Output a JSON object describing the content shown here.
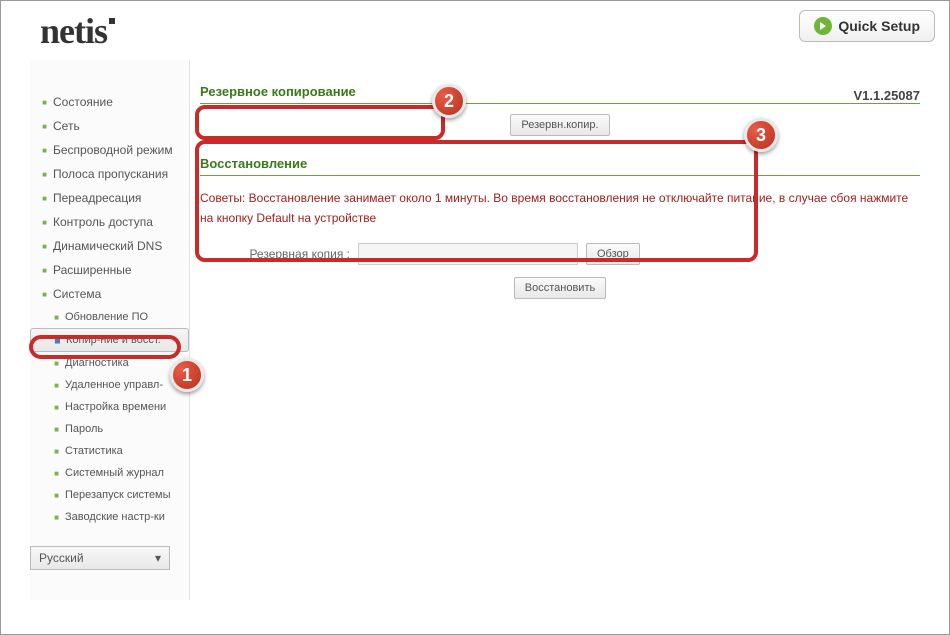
{
  "header": {
    "logo": "netis",
    "quick_setup": "Quick Setup",
    "version": "V1.1.25087"
  },
  "sidebar": {
    "items": [
      "Состояние",
      "Сеть",
      "Беспроводной режим",
      "Полоса пропускания",
      "Переадресация",
      "Контроль доступа",
      "Динамический DNS",
      "Расширенные",
      "Система"
    ],
    "sub_items": [
      "Обновление ПО",
      "Копир-ние и восст.",
      "Диагностика",
      "Удаленное управл-",
      "Настройка времени",
      "Пароль",
      "Статистика",
      "Системный журнал",
      "Перезапуск системы",
      "Заводские настр-ки"
    ],
    "language": "Русский"
  },
  "backup": {
    "title": "Резервное копирование",
    "button": "Резервн.копир."
  },
  "restore": {
    "title": "Восстановление",
    "hint": "Советы: Восстановление занимает около 1 минуты. Во время восстановления не отключайте питание, в случае сбоя нажмите на кнопку Default на устройстве",
    "file_label": "Резервная копия :",
    "file_value": "",
    "browse": "Обзор",
    "restore_btn": "Восстановить"
  },
  "annotations": {
    "b1": "1",
    "b2": "2",
    "b3": "3"
  }
}
